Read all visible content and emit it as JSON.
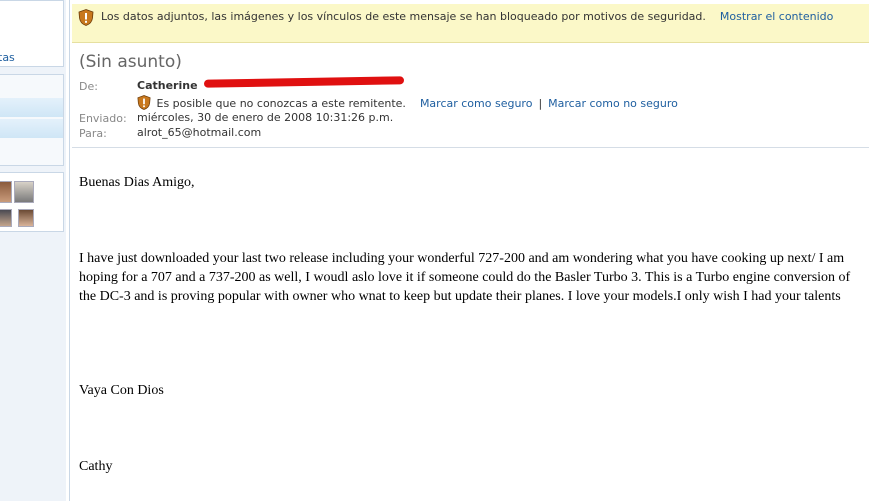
{
  "security_bar": {
    "message": "Los datos adjuntos, las imágenes y los vínculos de este mensaje se han bloqueado por motivos de seguridad.",
    "show_link": "Mostrar el contenido"
  },
  "sidebar": {
    "link_fragment": "tas"
  },
  "message": {
    "subject": "(Sin asunto)",
    "from_label": "De:",
    "from_name": "Catherine",
    "unknown_sender_warning": "Es posible que no conozcas a este remitente.",
    "mark_safe": "Marcar como seguro",
    "separator": "|",
    "mark_unsafe": "Marcar como no seguro",
    "sent_label": "Enviado:",
    "sent_value": "miércoles, 30 de enero de 2008 10:31:26 p.m.",
    "to_label": "Para:",
    "to_value": "alrot_65@hotmail.com"
  },
  "body": {
    "greeting": "Buenas Dias Amigo,",
    "paragraph": "I have just downloaded your last two release including your wonderful 727-200 and am wondering what you have cooking up next/  I am hoping for a 707 and a 737-200 as well, I woudl aslo love it if someone could do the Basler Turbo 3. This is a Turbo engine conversion of the DC-3 and is proving popular with owner who wnat to keep but update their planes. I love your models.I only wish I had your talents",
    "closing": "Vaya Con Dios",
    "signature": "Cathy"
  },
  "colors": {
    "link": "#1f5fa0",
    "security_bar_bg": "#fbf8c8",
    "redaction": "#e01010"
  }
}
